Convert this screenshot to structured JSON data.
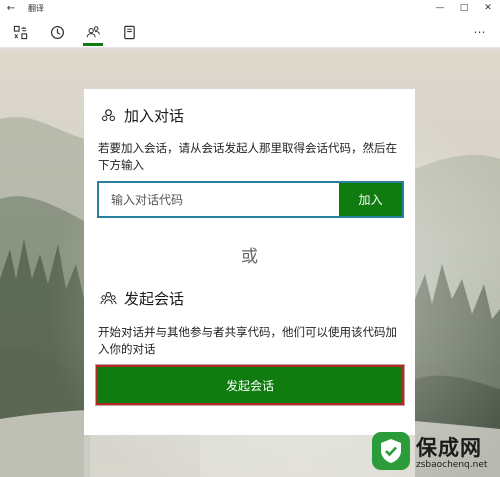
{
  "window": {
    "title": "翻译",
    "back_icon": "arrow-left-icon",
    "controls": [
      "minimize-icon",
      "maximize-icon",
      "close-icon"
    ]
  },
  "tabs": [
    {
      "id": "translate",
      "icon": "translate-icon",
      "active": false
    },
    {
      "id": "history",
      "icon": "clock-icon",
      "active": false
    },
    {
      "id": "conversation",
      "icon": "people-icon",
      "active": true
    },
    {
      "id": "phrasebook",
      "icon": "book-icon",
      "active": false
    }
  ],
  "more_icon": "more-icon",
  "join": {
    "title": "加入对话",
    "description": "若要加入会话，请从会话发起人那里取得会话代码，然后在下方输入",
    "placeholder": "输入对话代码",
    "button": "加入"
  },
  "or_text": "或",
  "start": {
    "title": "发起会话",
    "description": "开始对话并与其他参与者共享代码，他们可以使用该代码加入你的对话",
    "button": "发起会话"
  },
  "watermark": {
    "name": "保成网",
    "url": "zsbaochenq.net"
  },
  "colors": {
    "accent": "#107c10",
    "input_border": "#2a7f9d",
    "start_button_outline": "#b02a2a"
  }
}
